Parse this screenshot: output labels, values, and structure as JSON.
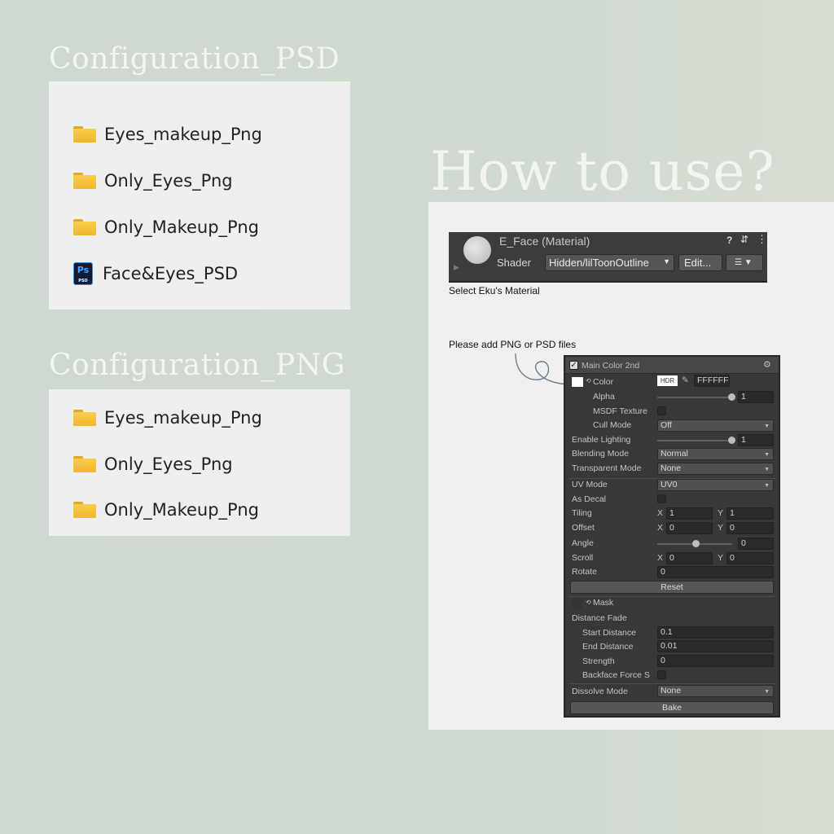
{
  "psd_section": {
    "heading": "Configuration_PSD",
    "items": [
      {
        "icon": "folder-icon",
        "name": "Eyes_makeup_Png"
      },
      {
        "icon": "folder-icon",
        "name": "Only_Eyes_Png"
      },
      {
        "icon": "folder-icon",
        "name": "Only_Makeup_Png"
      },
      {
        "icon": "photoshop-file-icon",
        "name": "Face&Eyes_PSD",
        "icon_text": "Ps",
        "icon_subtext": "PSD"
      }
    ]
  },
  "png_section": {
    "heading": "Configuration_PNG",
    "items": [
      {
        "icon": "folder-icon",
        "name": "Eyes_makeup_Png"
      },
      {
        "icon": "folder-icon",
        "name": "Only_Eyes_Png"
      },
      {
        "icon": "folder-icon",
        "name": "Only_Makeup_Png"
      }
    ]
  },
  "how_to": {
    "heading": "How to use?",
    "note_select": "Select Eku's Material",
    "note_add": "Please add PNG or PSD files"
  },
  "material": {
    "title": "E_Face (Material)",
    "shader_label": "Shader",
    "shader_value": "Hidden/lilToonOutline",
    "edit_label": "Edit..."
  },
  "inspector": {
    "section_title": "Main Color 2nd",
    "color_label": "Color",
    "hdr_label": "HDR",
    "color_hex": "FFFFFF",
    "alpha_label": "Alpha",
    "alpha_value": "1",
    "msdf_label": "MSDF Texture",
    "cull_label": "Cull Mode",
    "cull_value": "Off",
    "enable_lighting_label": "Enable Lighting",
    "enable_lighting_value": "1",
    "blending_label": "Blending Mode",
    "blending_value": "Normal",
    "transparent_label": "Transparent Mode",
    "transparent_value": "None",
    "uv_label": "UV Mode",
    "uv_value": "UV0",
    "decal_label": "As Decal",
    "tiling_label": "Tiling",
    "tiling_x": "1",
    "tiling_y": "1",
    "offset_label": "Offset",
    "offset_x": "0",
    "offset_y": "0",
    "angle_label": "Angle",
    "angle_value": "0",
    "scroll_label": "Scroll",
    "scroll_x": "0",
    "scroll_y": "0",
    "rotate_label": "Rotate",
    "rotate_value": "0",
    "reset_label": "Reset",
    "mask_label": "Mask",
    "distance_fade_label": "Distance Fade",
    "start_distance_label": "Start Distance",
    "start_distance_value": "0.1",
    "end_distance_label": "End Distance",
    "end_distance_value": "0.01",
    "strength_label": "Strength",
    "strength_value": "0",
    "backface_label": "Backface Force S",
    "dissolve_label": "Dissolve Mode",
    "dissolve_value": "None",
    "bake_label": "Bake",
    "x_label": "X",
    "y_label": "Y"
  }
}
